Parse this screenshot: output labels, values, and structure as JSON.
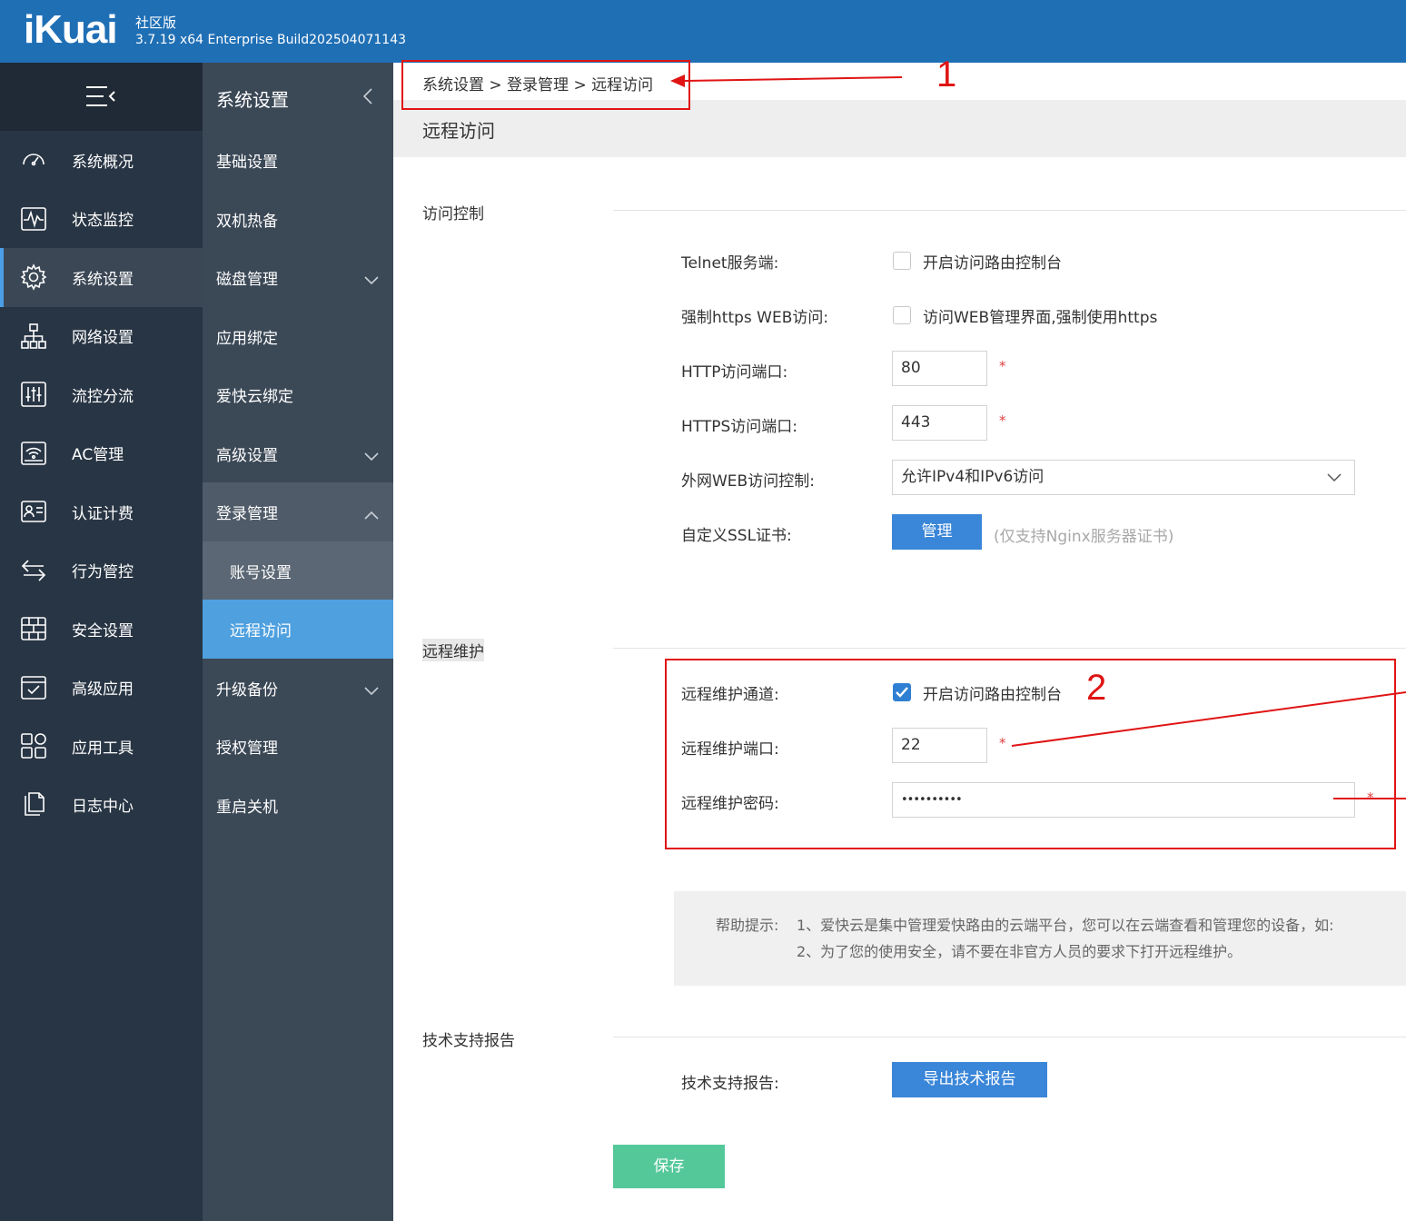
{
  "header": {
    "logo": "iKuai",
    "edition": "社区版",
    "build": "3.7.19 x64 Enterprise Build202504071143"
  },
  "nav_primary": [
    {
      "label": "系统概况",
      "icon": "dashboard-icon"
    },
    {
      "label": "状态监控",
      "icon": "monitor-icon"
    },
    {
      "label": "系统设置",
      "icon": "gear-icon",
      "active": true
    },
    {
      "label": "网络设置",
      "icon": "network-icon"
    },
    {
      "label": "流控分流",
      "icon": "sliders-icon"
    },
    {
      "label": "AC管理",
      "icon": "wifi-icon"
    },
    {
      "label": "认证计费",
      "icon": "id-card-icon"
    },
    {
      "label": "行为管控",
      "icon": "swap-icon"
    },
    {
      "label": "安全设置",
      "icon": "firewall-icon"
    },
    {
      "label": "高级应用",
      "icon": "checklist-icon"
    },
    {
      "label": "应用工具",
      "icon": "apps-icon"
    },
    {
      "label": "日志中心",
      "icon": "files-icon"
    }
  ],
  "nav_secondary": {
    "title": "系统设置",
    "items": [
      {
        "label": "基础设置"
      },
      {
        "label": "双机热备"
      },
      {
        "label": "磁盘管理"
      },
      {
        "label": "应用绑定"
      },
      {
        "label": "爱快云绑定"
      },
      {
        "label": "高级设置"
      },
      {
        "label": "登录管理"
      },
      {
        "label": "账号设置"
      },
      {
        "label": "远程访问"
      },
      {
        "label": "升级备份"
      },
      {
        "label": "授权管理"
      },
      {
        "label": "重启关机"
      }
    ]
  },
  "breadcrumb": "系统设置 > 登录管理 > 远程访问",
  "page_title": "远程访问",
  "access_control": {
    "section": "访问控制",
    "telnet_label": "Telnet服务端:",
    "telnet_text": "开启访问路由控制台",
    "https_label": "强制https WEB访问:",
    "https_text": "访问WEB管理界面,强制使用https",
    "http_port_label": "HTTP访问端口:",
    "http_port": "80",
    "https_port_label": "HTTPS访问端口:",
    "https_port": "443",
    "wan_label": "外网WEB访问控制:",
    "wan_value": "允许IPv4和IPv6访问",
    "ssl_label": "自定义SSL证书:",
    "ssl_button": "管理",
    "ssl_hint": "(仅支持Nginx服务器证书)",
    "required_mark": "*"
  },
  "remote_maint": {
    "section": "远程维护",
    "channel_label": "远程维护通道:",
    "channel_text": "开启访问路由控制台",
    "port_label": "远程维护端口:",
    "port": "22",
    "password_label": "远程维护密码:",
    "password": "••••••••••"
  },
  "help": {
    "prefix": "帮助提示:",
    "line1": "1、爱快云是集中管理爱快路由的云端平台，您可以在云端查看和管理您的设备，如:",
    "line2": "2、为了您的使用安全，请不要在非官方人员的要求下打开远程维护。"
  },
  "tech_report": {
    "section": "技术支持报告",
    "label": "技术支持报告:",
    "button": "导出技术报告"
  },
  "save_button": "保存",
  "annotations": {
    "one": "1",
    "two": "2"
  },
  "colors": {
    "header": "#1f6fb5",
    "accent": "#3a86d8",
    "save": "#55c89a",
    "annotation": "#e01414"
  }
}
